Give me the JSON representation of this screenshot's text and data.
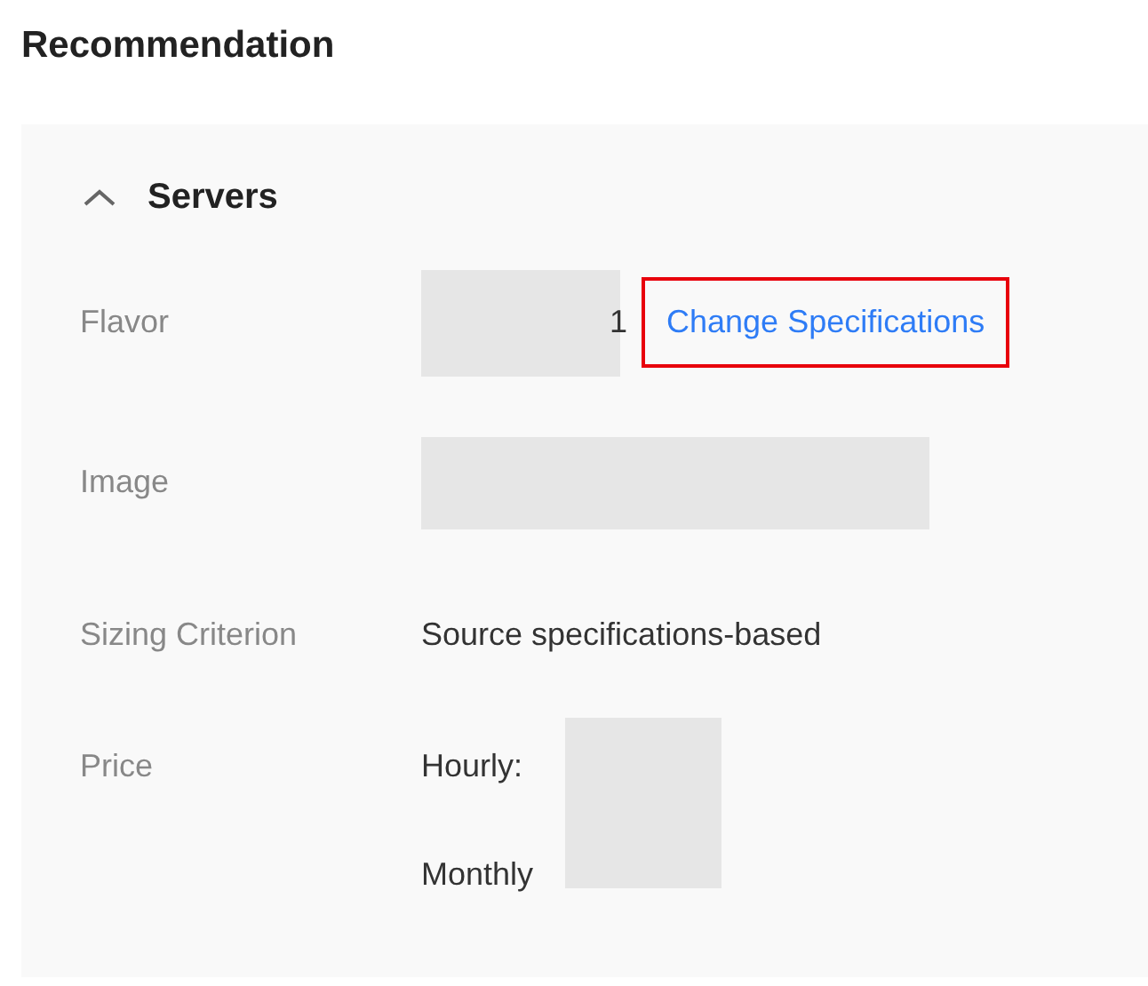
{
  "title": "Recommendation",
  "section": {
    "title": "Servers",
    "expanded": true,
    "rows": [
      {
        "kind": "flavor",
        "label": "Flavor",
        "value": "1",
        "link": "Change Specifications",
        "highlighted": true
      },
      {
        "kind": "hidden",
        "label": "Image"
      },
      {
        "kind": "text",
        "label": "Sizing Criterion",
        "value": "Source specifications-based"
      },
      {
        "kind": "price",
        "label": "Price",
        "lines": [
          "Hourly:",
          "Monthly"
        ]
      }
    ]
  }
}
